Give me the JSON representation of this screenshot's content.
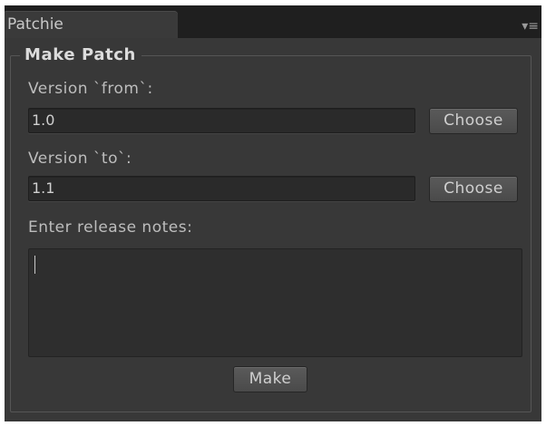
{
  "window": {
    "tab_title": "Patchie",
    "menu_icon": "tab-menu-icon"
  },
  "panel": {
    "group_title": "Make Patch",
    "version_from": {
      "label": "Version `from`:",
      "value": "1.0",
      "button_label": "Choose"
    },
    "version_to": {
      "label": "Version `to`:",
      "value": "1.1",
      "button_label": "Choose"
    },
    "release_notes": {
      "label": "Enter release notes:",
      "value": ""
    },
    "make_button_label": "Make"
  },
  "colors": {
    "window_bg": "#383838",
    "field_bg": "#2a2a2a",
    "text": "#bdbdbd"
  }
}
